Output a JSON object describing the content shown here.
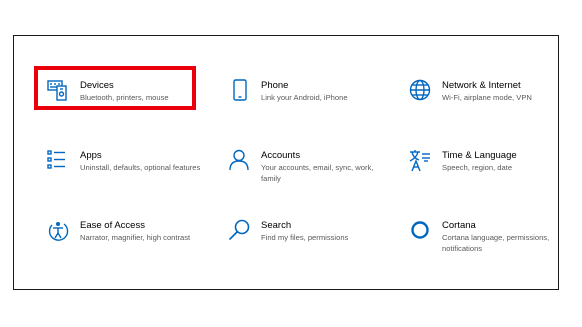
{
  "colors": {
    "accent": "#0067c0",
    "highlight": "#e8000b",
    "title": "#000000",
    "description": "#5a5a5a"
  },
  "tiles": [
    {
      "icon": "devices-icon",
      "title": "Devices",
      "desc": "Bluetooth, printers, mouse"
    },
    {
      "icon": "phone-icon",
      "title": "Phone",
      "desc": "Link your Android, iPhone"
    },
    {
      "icon": "globe-icon",
      "title": "Network & Internet",
      "desc": "Wi-Fi, airplane mode, VPN"
    },
    {
      "icon": "apps-icon",
      "title": "Apps",
      "desc": "Uninstall, defaults, optional features"
    },
    {
      "icon": "person-icon",
      "title": "Accounts",
      "desc": "Your accounts, email, sync, work, family"
    },
    {
      "icon": "language-icon",
      "title": "Time & Language",
      "desc": "Speech, region, date"
    },
    {
      "icon": "ease-of-access-icon",
      "title": "Ease of Access",
      "desc": "Narrator, magnifier, high contrast"
    },
    {
      "icon": "search-icon",
      "title": "Search",
      "desc": "Find my files, permissions"
    },
    {
      "icon": "cortana-icon",
      "title": "Cortana",
      "desc": "Cortana language, permissions, notifications"
    }
  ]
}
